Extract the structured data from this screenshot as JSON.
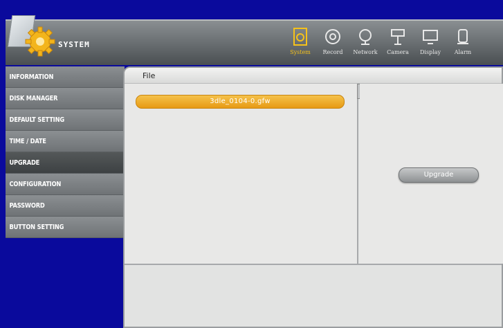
{
  "app": {
    "title": "SYSTEM"
  },
  "top_nav": [
    {
      "label": "System",
      "icon": "system-icon",
      "active": true
    },
    {
      "label": "Record",
      "icon": "record-icon",
      "active": false
    },
    {
      "label": "Network",
      "icon": "network-icon",
      "active": false
    },
    {
      "label": "Camera",
      "icon": "camera-icon",
      "active": false
    },
    {
      "label": "Display",
      "icon": "display-icon",
      "active": false
    },
    {
      "label": "Alarm",
      "icon": "alarm-icon",
      "active": false
    }
  ],
  "sidebar": {
    "items": [
      {
        "label": "INFORMATION"
      },
      {
        "label": "DISK MANAGER"
      },
      {
        "label": "DEFAULT SETTING"
      },
      {
        "label": "TIME / DATE"
      },
      {
        "label": "UPGRADE",
        "active": true
      },
      {
        "label": "CONFIGURATION"
      },
      {
        "label": "PASSWORD"
      },
      {
        "label": "BUTTON SETTING"
      }
    ]
  },
  "panel": {
    "file_header": "File",
    "files": [
      "3dle_0104-0.gfw"
    ],
    "upgrade_label": "Upgrade"
  },
  "colors": {
    "background": "#0a0a9c",
    "accent": "#f6c21a",
    "selected_file": "#eba21b"
  }
}
